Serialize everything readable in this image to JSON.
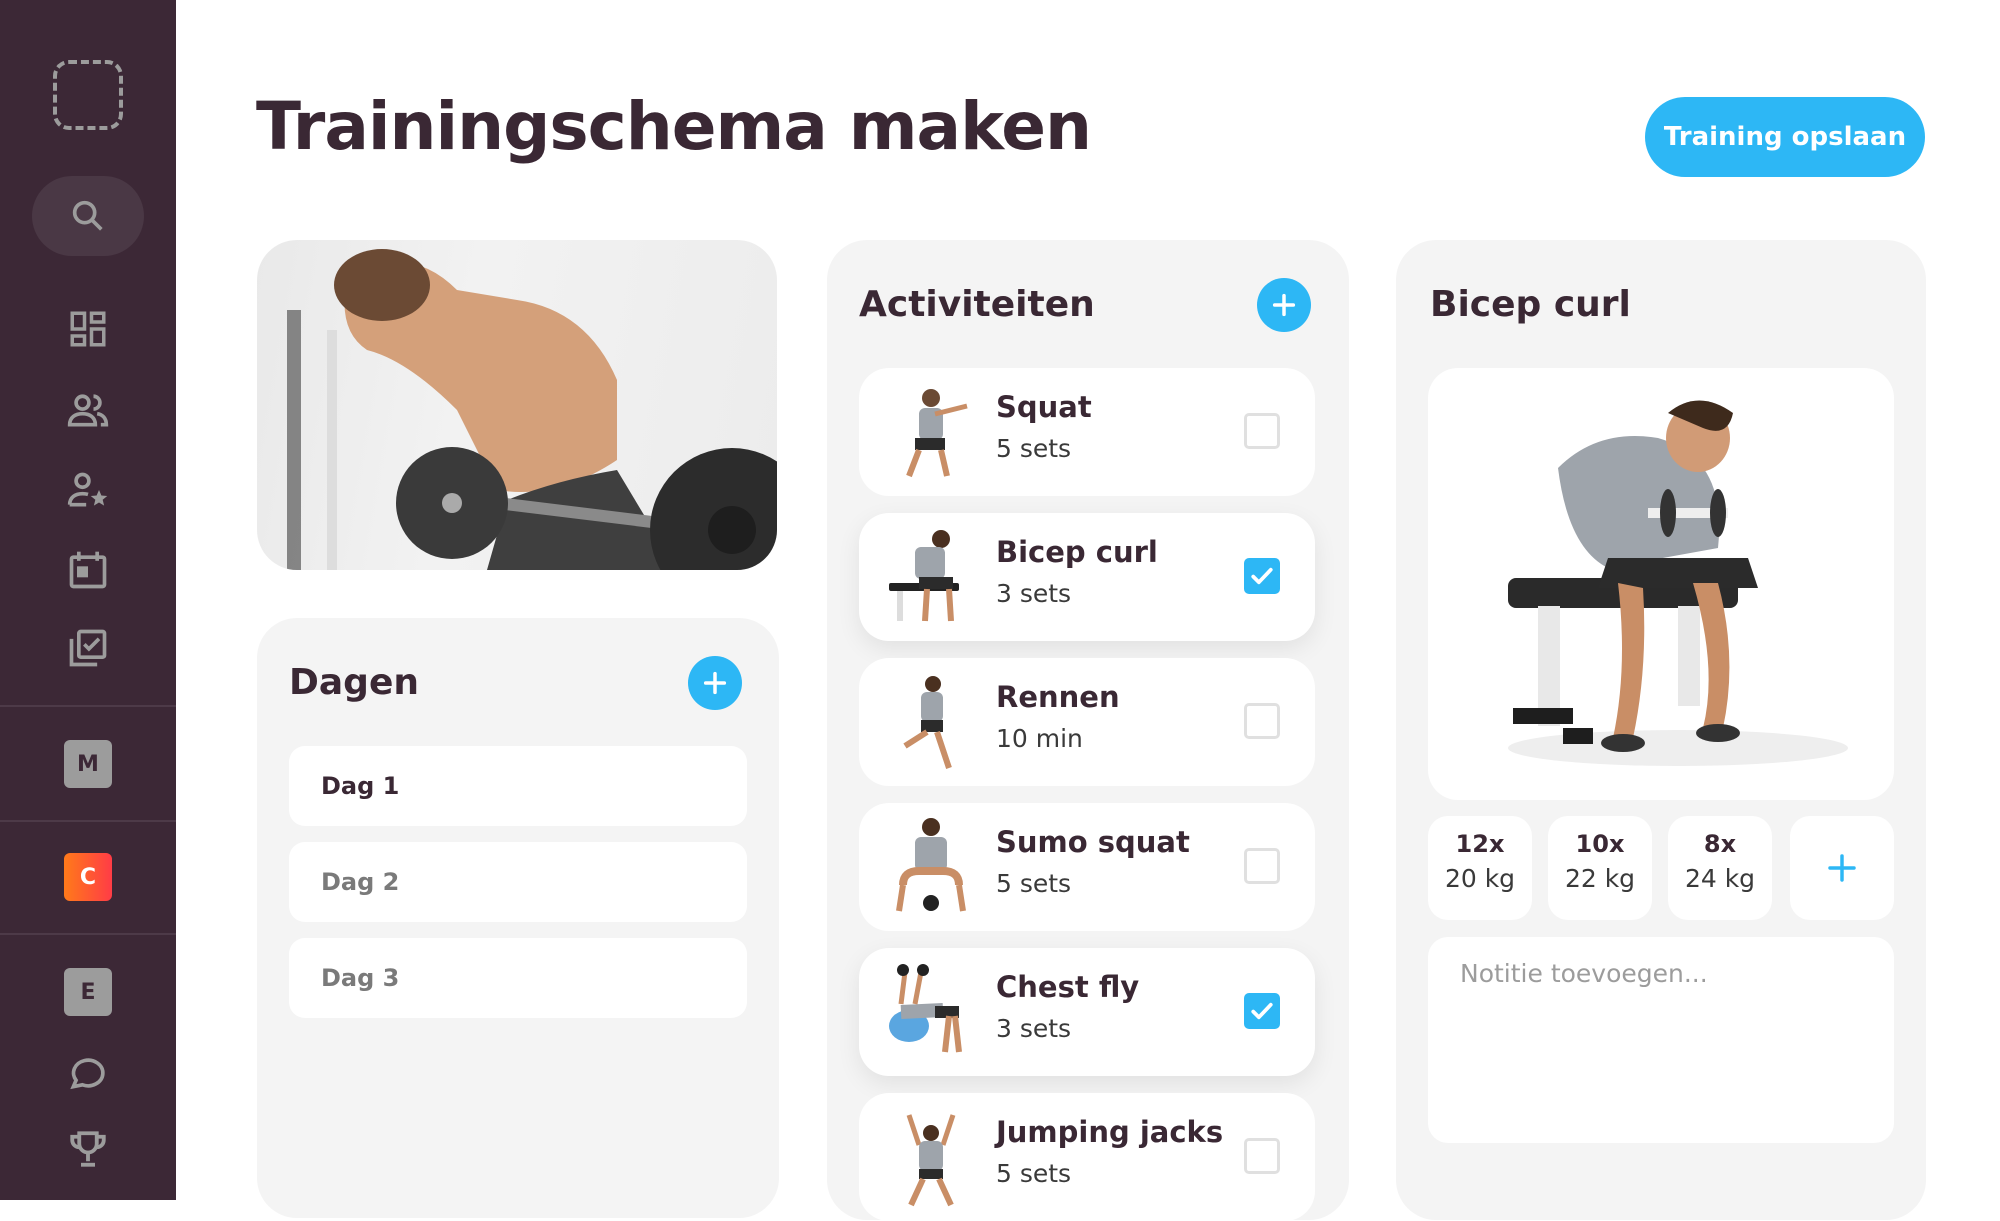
{
  "sidebar": {
    "logo_icon": "dashed-square-logo",
    "items": [
      {
        "icon": "search-icon"
      },
      {
        "icon": "dashboard-icon"
      },
      {
        "icon": "users-icon"
      },
      {
        "icon": "user-star-icon"
      },
      {
        "icon": "calendar-icon"
      },
      {
        "icon": "checklist-icon"
      }
    ],
    "badges": [
      {
        "label": "M"
      },
      {
        "label": "C"
      },
      {
        "label": "E"
      }
    ],
    "bottom_items": [
      {
        "icon": "chat-icon"
      },
      {
        "icon": "trophy-icon"
      }
    ]
  },
  "header": {
    "title": "Trainingschema maken",
    "save_label": "Training opslaan"
  },
  "days": {
    "title": "Dagen",
    "items": [
      {
        "label": "Dag 1",
        "active": true
      },
      {
        "label": "Dag 2",
        "active": false
      },
      {
        "label": "Dag 3",
        "active": false
      }
    ]
  },
  "activities": {
    "title": "Activiteiten",
    "items": [
      {
        "name": "Squat",
        "meta": "5 sets",
        "checked": false
      },
      {
        "name": "Bicep curl",
        "meta": "3 sets",
        "checked": true
      },
      {
        "name": "Rennen",
        "meta": "10 min",
        "checked": false
      },
      {
        "name": "Sumo squat",
        "meta": "5 sets",
        "checked": false
      },
      {
        "name": "Chest fly",
        "meta": "3 sets",
        "checked": true
      },
      {
        "name": "Jumping jacks",
        "meta": "5 sets",
        "checked": false
      }
    ]
  },
  "detail": {
    "title": "Bicep curl",
    "sets": [
      {
        "reps": "12x",
        "weight": "20 kg"
      },
      {
        "reps": "10x",
        "weight": "22 kg"
      },
      {
        "reps": "8x",
        "weight": "24 kg"
      }
    ],
    "note_placeholder": "Notitie toevoegen..."
  },
  "colors": {
    "sidebar_bg": "#3c2836",
    "accent": "#2db7f5",
    "text_dark": "#3a2834",
    "card_bg": "#f4f4f4"
  }
}
